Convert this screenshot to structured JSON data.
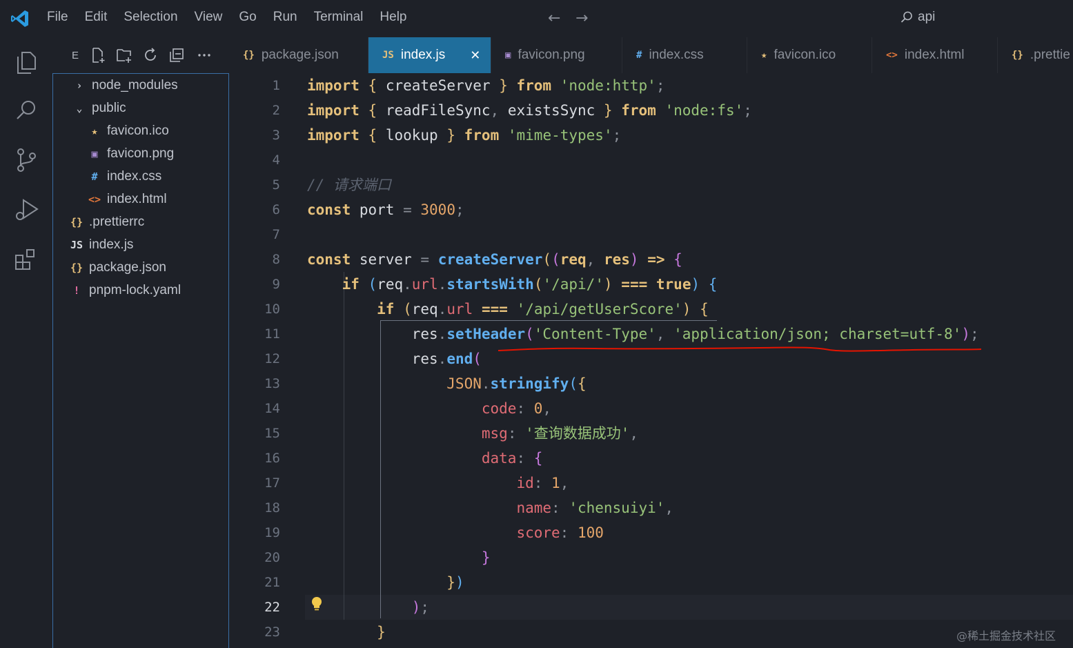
{
  "menu": {
    "items": [
      "File",
      "Edit",
      "Selection",
      "View",
      "Go",
      "Run",
      "Terminal",
      "Help"
    ]
  },
  "command_center": {
    "label": "api"
  },
  "explorer": {
    "title": "E",
    "tree": [
      {
        "label": "node_modules",
        "type": "folder",
        "icon": "›",
        "icon_color": "#c0c4cc"
      },
      {
        "label": "public",
        "type": "folder-open",
        "icon": "⌄",
        "icon_color": "#c0c4cc"
      },
      {
        "label": "favicon.ico",
        "type": "file",
        "icon": "★",
        "icon_color": "#e5c07b"
      },
      {
        "label": "favicon.png",
        "type": "file",
        "icon": "▣",
        "icon_color": "#a78bd0"
      },
      {
        "label": "index.css",
        "type": "file",
        "icon": "#",
        "icon_color": "#61afef"
      },
      {
        "label": "index.html",
        "type": "file",
        "icon": "<>",
        "icon_color": "#e0763b"
      },
      {
        "label": ".prettierrc",
        "type": "file",
        "icon": "{}",
        "icon_color": "#e5c07b"
      },
      {
        "label": "index.js",
        "type": "file",
        "icon": "JS",
        "icon_color": "#d8dbe0"
      },
      {
        "label": "package.json",
        "type": "file",
        "icon": "{}",
        "icon_color": "#e5c07b"
      },
      {
        "label": "pnpm-lock.yaml",
        "type": "file",
        "icon": "!",
        "icon_color": "#e06c9f"
      }
    ]
  },
  "tabs": [
    {
      "label": "package.json",
      "icon": "{}",
      "icon_color": "#e5c07b",
      "active": false
    },
    {
      "label": "index.js",
      "icon": "JS",
      "icon_color": "#e5c07b",
      "active": true,
      "close": "✕"
    },
    {
      "label": "favicon.png",
      "icon": "▣",
      "icon_color": "#a78bd0",
      "active": false
    },
    {
      "label": "index.css",
      "icon": "#",
      "icon_color": "#61afef",
      "active": false
    },
    {
      "label": "favicon.ico",
      "icon": "★",
      "icon_color": "#e5c07b",
      "active": false
    },
    {
      "label": "index.html",
      "icon": "<>",
      "icon_color": "#e0763b",
      "active": false
    },
    {
      "label": ".prettie",
      "icon": "{}",
      "icon_color": "#e5c07b",
      "active": false
    }
  ],
  "editor": {
    "current_line": 22,
    "lines": [
      [
        [
          "import",
          "kw"
        ],
        [
          " "
        ],
        [
          "{",
          "br1"
        ],
        [
          " createServer "
        ],
        [
          "}",
          "br1"
        ],
        [
          " "
        ],
        [
          "from",
          "kw"
        ],
        [
          " "
        ],
        [
          "'node:http'",
          "str"
        ],
        [
          ";",
          "punc"
        ]
      ],
      [
        [
          "import",
          "kw"
        ],
        [
          " "
        ],
        [
          "{",
          "br1"
        ],
        [
          " readFileSync"
        ],
        [
          ",",
          "punc"
        ],
        [
          " existsSync "
        ],
        [
          "}",
          "br1"
        ],
        [
          " "
        ],
        [
          "from",
          "kw"
        ],
        [
          " "
        ],
        [
          "'node:fs'",
          "str"
        ],
        [
          ";",
          "punc"
        ]
      ],
      [
        [
          "import",
          "kw"
        ],
        [
          " "
        ],
        [
          "{",
          "br1"
        ],
        [
          " lookup "
        ],
        [
          "}",
          "br1"
        ],
        [
          " "
        ],
        [
          "from",
          "kw"
        ],
        [
          " "
        ],
        [
          "'mime-types'",
          "str"
        ],
        [
          ";",
          "punc"
        ]
      ],
      [],
      [
        [
          "// 请求端口",
          "com"
        ]
      ],
      [
        [
          "const",
          "kw"
        ],
        [
          " port "
        ],
        [
          "=",
          "punc"
        ],
        [
          " "
        ],
        [
          "3000",
          "num"
        ],
        [
          ";",
          "punc"
        ]
      ],
      [],
      [
        [
          "const",
          "kw"
        ],
        [
          " server "
        ],
        [
          "=",
          "punc"
        ],
        [
          " "
        ],
        [
          "createServer",
          "fn"
        ],
        [
          "(",
          "br1"
        ],
        [
          "(",
          "br2"
        ],
        [
          "req",
          "kw"
        ],
        [
          ", ",
          "punc"
        ],
        [
          "res",
          "kw"
        ],
        [
          ")",
          "br2"
        ],
        [
          " "
        ],
        [
          "=>",
          "kw"
        ],
        [
          " "
        ],
        [
          "{",
          "br2"
        ]
      ],
      [
        [
          "    "
        ],
        [
          "if",
          "kw"
        ],
        [
          " "
        ],
        [
          "(",
          "br3"
        ],
        [
          "req"
        ],
        [
          ".",
          "punc"
        ],
        [
          "url",
          "prop"
        ],
        [
          ".",
          "punc"
        ],
        [
          "startsWith",
          "fn"
        ],
        [
          "(",
          "br1"
        ],
        [
          "'/api/'",
          "str"
        ],
        [
          ")",
          "br1"
        ],
        [
          " "
        ],
        [
          "===",
          "kw"
        ],
        [
          " "
        ],
        [
          "true",
          "kw"
        ],
        [
          ")",
          "br3"
        ],
        [
          " "
        ],
        [
          "{",
          "br3"
        ]
      ],
      [
        [
          "        "
        ],
        [
          "if",
          "kw"
        ],
        [
          " "
        ],
        [
          "(",
          "br1"
        ],
        [
          "req"
        ],
        [
          ".",
          "punc"
        ],
        [
          "url",
          "prop"
        ],
        [
          " "
        ],
        [
          "===",
          "kw"
        ],
        [
          " "
        ],
        [
          "'/api/getUserScore'",
          "str"
        ],
        [
          ")",
          "br1"
        ],
        [
          " "
        ],
        [
          "{",
          "br1"
        ]
      ],
      [
        [
          "            res"
        ],
        [
          ".",
          "punc"
        ],
        [
          "setHeader",
          "fn"
        ],
        [
          "(",
          "br2"
        ],
        [
          "'Content-Type'",
          "str"
        ],
        [
          ", ",
          "punc"
        ],
        [
          "'application/json; charset=utf-8'",
          "str"
        ],
        [
          ")",
          "br2"
        ],
        [
          ";",
          "punc"
        ]
      ],
      [
        [
          "            res"
        ],
        [
          ".",
          "punc"
        ],
        [
          "end",
          "fn"
        ],
        [
          "(",
          "br2"
        ]
      ],
      [
        [
          "                JSON",
          "num"
        ],
        [
          ".",
          "punc"
        ],
        [
          "stringify",
          "fn"
        ],
        [
          "(",
          "br3"
        ],
        [
          "{",
          "br1"
        ]
      ],
      [
        [
          "                    "
        ],
        [
          "code",
          "prop"
        ],
        [
          ": ",
          "punc"
        ],
        [
          "0",
          "num"
        ],
        [
          ",",
          "punc"
        ]
      ],
      [
        [
          "                    "
        ],
        [
          "msg",
          "prop"
        ],
        [
          ": ",
          "punc"
        ],
        [
          "'查询数据成功'",
          "str"
        ],
        [
          ",",
          "punc"
        ]
      ],
      [
        [
          "                    "
        ],
        [
          "data",
          "prop"
        ],
        [
          ": ",
          "punc"
        ],
        [
          "{",
          "br2"
        ]
      ],
      [
        [
          "                        "
        ],
        [
          "id",
          "prop"
        ],
        [
          ": ",
          "punc"
        ],
        [
          "1",
          "num"
        ],
        [
          ",",
          "punc"
        ]
      ],
      [
        [
          "                        "
        ],
        [
          "name",
          "prop"
        ],
        [
          ": ",
          "punc"
        ],
        [
          "'chensuiyi'",
          "str"
        ],
        [
          ",",
          "punc"
        ]
      ],
      [
        [
          "                        "
        ],
        [
          "score",
          "prop"
        ],
        [
          ": ",
          "punc"
        ],
        [
          "100",
          "num"
        ]
      ],
      [
        [
          "                    "
        ],
        [
          "}",
          "br2"
        ]
      ],
      [
        [
          "                "
        ],
        [
          "}",
          "br1"
        ],
        [
          ")",
          "br3"
        ]
      ],
      [
        [
          "            "
        ],
        [
          ")",
          "br2"
        ],
        [
          ";",
          "punc"
        ]
      ],
      [
        [
          "        "
        ],
        [
          "}",
          "br1"
        ]
      ]
    ]
  },
  "watermark": "@稀土掘金技术社区",
  "colors": {
    "accent_tab": "#1f6e9c",
    "error_squiggle": "#e51400",
    "background": "#1e2128"
  }
}
